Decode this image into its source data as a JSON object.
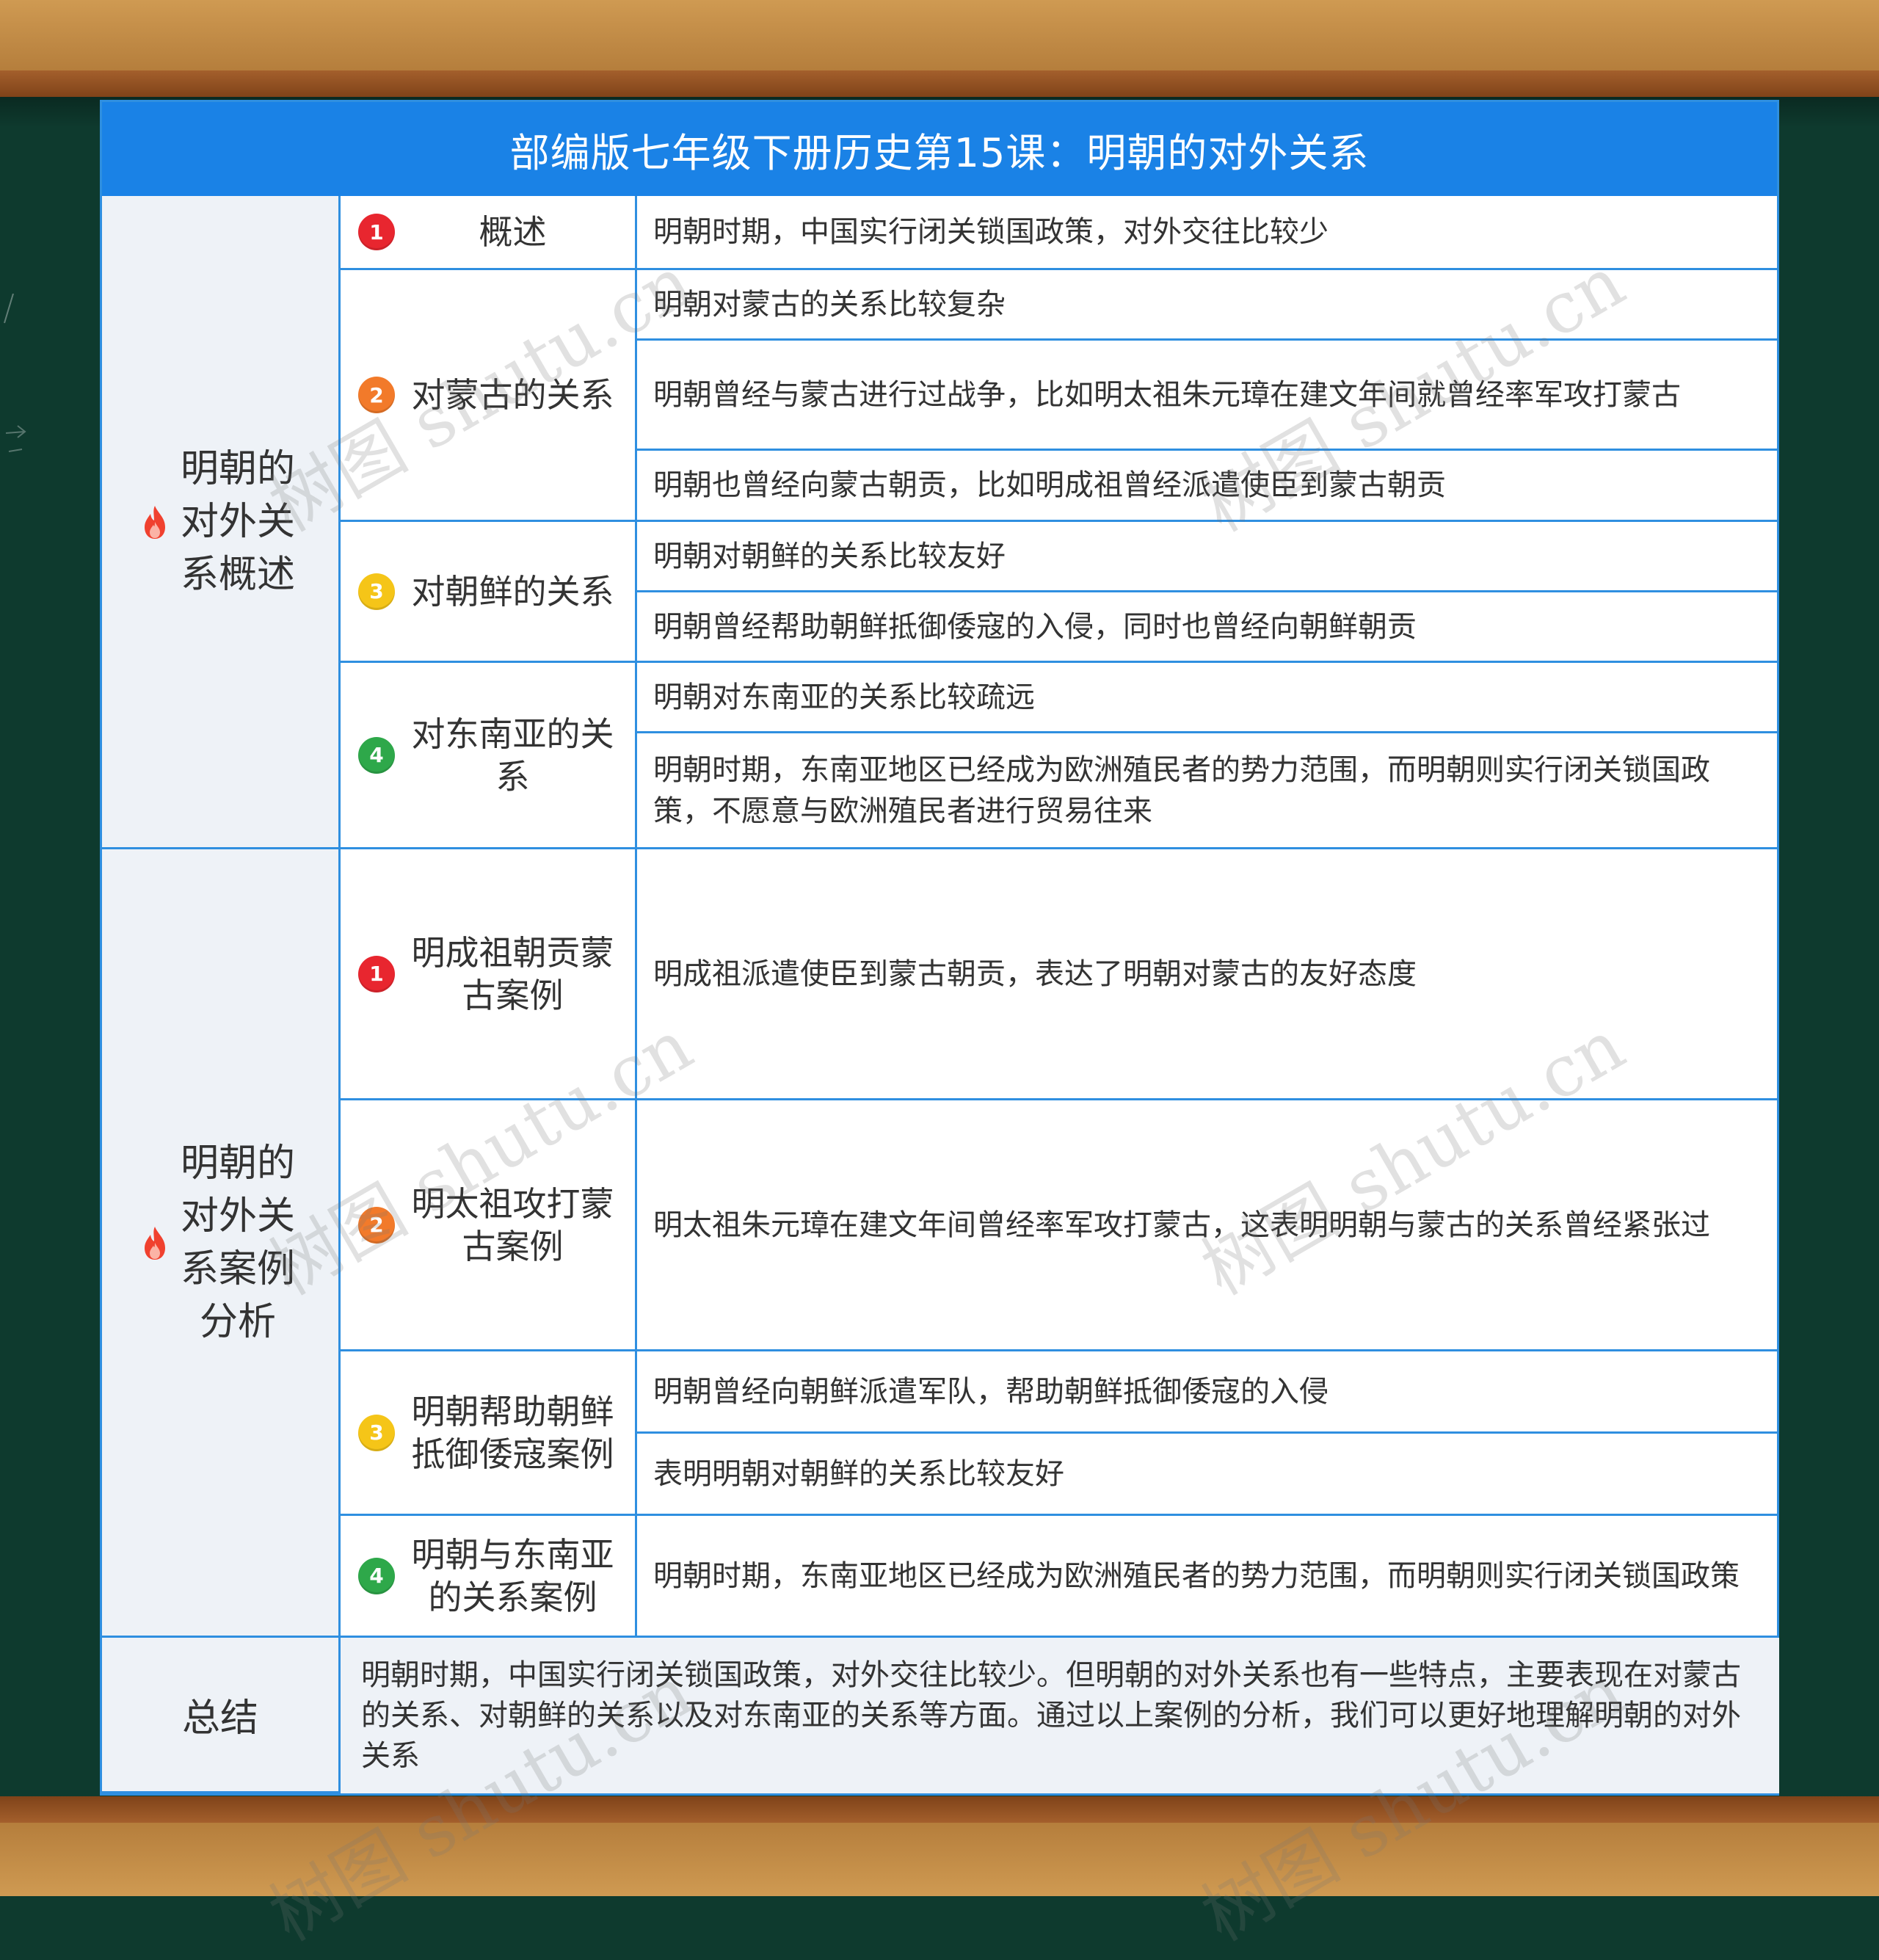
{
  "title": "部编版七年级下册历史第15课：明朝的对外关系",
  "colors": {
    "header": "#1a82e6",
    "border": "#2f8fe0",
    "section_bg": "#eef2f7",
    "badge_1": "#e8262f",
    "badge_2": "#f27a2a",
    "badge_3": "#f5c518",
    "badge_4": "#2ea84a",
    "frame_wood": "#b57e3c",
    "board": "#0e3a2e"
  },
  "sections": [
    {
      "label": "明朝的对外关系概述",
      "icon": "fire-icon",
      "subs": [
        {
          "num": "1",
          "label": "概述",
          "details": [
            "明朝时期，中国实行闭关锁国政策，对外交往比较少"
          ]
        },
        {
          "num": "2",
          "label": "对蒙古的关系",
          "details": [
            "明朝对蒙古的关系比较复杂",
            "明朝曾经与蒙古进行过战争，比如明太祖朱元璋在建文年间就曾经率军攻打蒙古",
            "明朝也曾经向蒙古朝贡，比如明成祖曾经派遣使臣到蒙古朝贡"
          ]
        },
        {
          "num": "3",
          "label": "对朝鲜的关系",
          "details": [
            "明朝对朝鲜的关系比较友好",
            "明朝曾经帮助朝鲜抵御倭寇的入侵，同时也曾经向朝鲜朝贡"
          ]
        },
        {
          "num": "4",
          "label": "对东南亚的关系",
          "details": [
            "明朝对东南亚的关系比较疏远",
            "明朝时期，东南亚地区已经成为欧洲殖民者的势力范围，而明朝则实行闭关锁国政策，不愿意与欧洲殖民者进行贸易往来"
          ]
        }
      ]
    },
    {
      "label": "明朝的对外关系案例分析",
      "icon": "fire-icon",
      "subs": [
        {
          "num": "1",
          "label": "明成祖朝贡蒙古案例",
          "details": [
            "明成祖派遣使臣到蒙古朝贡，表达了明朝对蒙古的友好态度"
          ]
        },
        {
          "num": "2",
          "label": "明太祖攻打蒙古案例",
          "details": [
            "明太祖朱元璋在建文年间曾经率军攻打蒙古，这表明明朝与蒙古的关系曾经紧张过"
          ]
        },
        {
          "num": "3",
          "label": "明朝帮助朝鲜抵御倭寇案例",
          "details": [
            "明朝曾经向朝鲜派遣军队，帮助朝鲜抵御倭寇的入侵",
            "表明明朝对朝鲜的关系比较友好"
          ]
        },
        {
          "num": "4",
          "label": "明朝与东南亚的关系案例",
          "details": [
            "明朝时期，东南亚地区已经成为欧洲殖民者的势力范围，而明朝则实行闭关锁国政策"
          ]
        }
      ]
    }
  ],
  "summary": {
    "label": "总结",
    "text": "明朝时期，中国实行闭关锁国政策，对外交往比较少。但明朝的对外关系也有一些特点，主要表现在对蒙古的关系、对朝鲜的关系以及对东南亚的关系等方面。通过以上案例的分析，我们可以更好地理解明朝的对外关系"
  },
  "watermark": "树图 shutu.cn"
}
